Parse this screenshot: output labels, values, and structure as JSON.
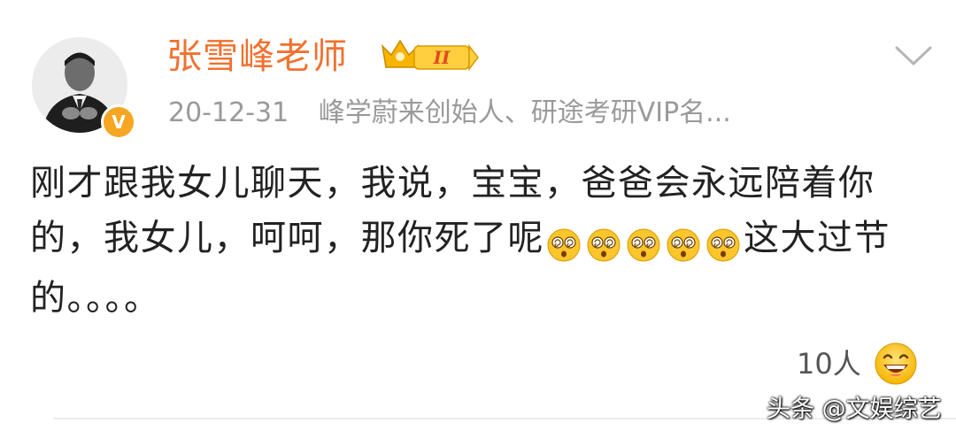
{
  "user": {
    "name": "张雪峰老师",
    "verified_badge": "V",
    "vip_level": "II"
  },
  "meta": {
    "date": "20-12-31",
    "bio": "峰学蔚来创始人、研途考研VIP名..."
  },
  "post": {
    "text_part1": "刚才跟我女儿聊天，我说，宝宝，爸爸会永远陪着你的，我女儿，呵呵，那你死了呢",
    "emoji_name": "dizzy-face-emoji",
    "emoji_count": 5,
    "text_part2": "这大过节的。。。。"
  },
  "reactions": {
    "count": "10人",
    "icon": "laughing-face-icon"
  },
  "watermark": "头条 @文娱综艺",
  "colors": {
    "username": "#f0712f",
    "meta": "#9a9a9a",
    "text": "#222222",
    "verified": "#f5a623"
  }
}
